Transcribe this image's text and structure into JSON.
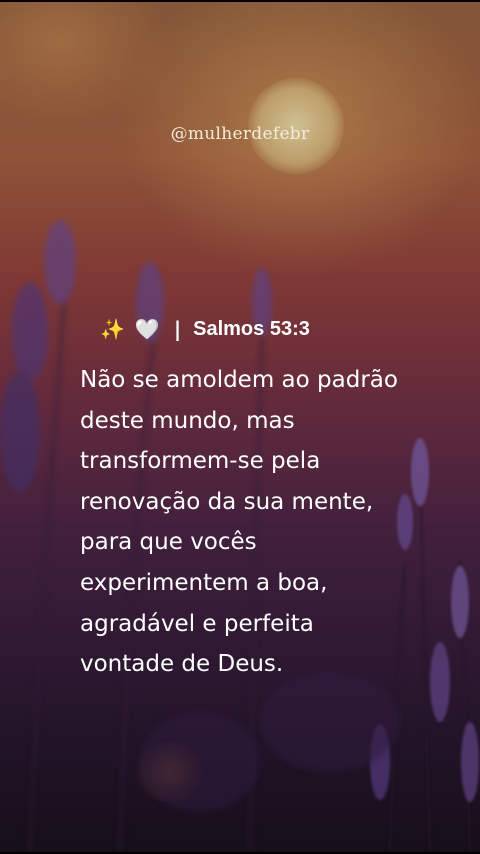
{
  "handle": "@mulherdefebr",
  "header": {
    "sparkle_emoji": "✨",
    "heart_emoji": "🤍",
    "separator": "|",
    "reference": "Salmos 53:3"
  },
  "verse_lines": [
    "Não se amoldem ao padrão",
    "deste mundo, mas",
    "transformem-se pela",
    "renovação da sua mente,",
    "para que vocês",
    "experimentem a boa,",
    "agradável e perfeita",
    "vontade de Deus."
  ]
}
